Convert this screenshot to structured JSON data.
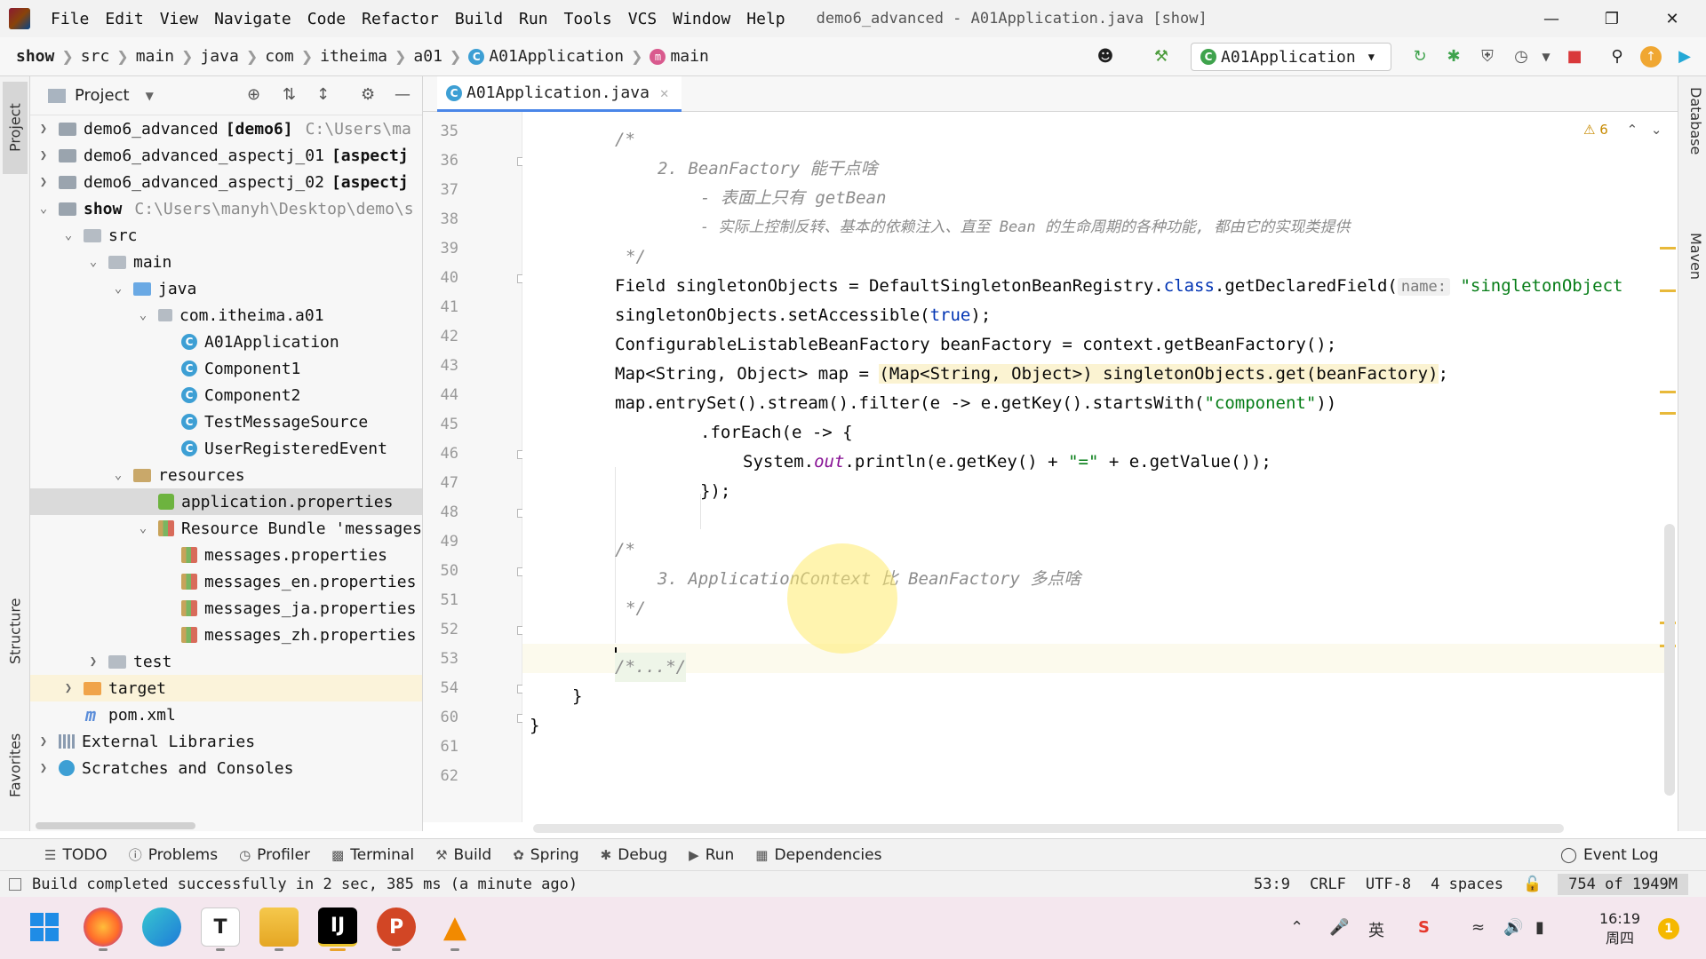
{
  "menu": {
    "items": [
      "File",
      "Edit",
      "View",
      "Navigate",
      "Code",
      "Refactor",
      "Build",
      "Run",
      "Tools",
      "VCS",
      "Window",
      "Help"
    ],
    "window_title": "demo6_advanced - A01Application.java [show]"
  },
  "breadcrumb": [
    "show",
    "src",
    "main",
    "java",
    "com",
    "itheima",
    "a01",
    "A01Application",
    "main"
  ],
  "run_config": "A01Application",
  "project_panel": {
    "title": "Project",
    "tree": [
      {
        "name": "demo6_advanced",
        "tag": "[demo6]",
        "path": "C:\\Users\\ma"
      },
      {
        "name": "demo6_advanced_aspectj_01",
        "tag": "[aspectj",
        "path": ""
      },
      {
        "name": "demo6_advanced_aspectj_02",
        "tag": "[aspectj",
        "path": ""
      },
      {
        "name": "show",
        "tag": "",
        "path": "C:\\Users\\manyh\\Desktop\\demo\\s"
      },
      {
        "name": "src"
      },
      {
        "name": "main"
      },
      {
        "name": "java"
      },
      {
        "name": "com.itheima.a01"
      },
      {
        "name": "A01Application"
      },
      {
        "name": "Component1"
      },
      {
        "name": "Component2"
      },
      {
        "name": "TestMessageSource"
      },
      {
        "name": "UserRegisteredEvent"
      },
      {
        "name": "resources"
      },
      {
        "name": "application.properties"
      },
      {
        "name": "Resource Bundle 'messages'"
      },
      {
        "name": "messages.properties"
      },
      {
        "name": "messages_en.properties"
      },
      {
        "name": "messages_ja.properties"
      },
      {
        "name": "messages_zh.properties"
      },
      {
        "name": "test"
      },
      {
        "name": "target"
      },
      {
        "name": "pom.xml"
      },
      {
        "name": "External Libraries"
      },
      {
        "name": "Scratches and Consoles"
      }
    ]
  },
  "editor": {
    "tab": "A01Application.java",
    "warnings": "6",
    "line_numbers": [
      "35",
      "36",
      "37",
      "38",
      "39",
      "40",
      "41",
      "42",
      "43",
      "44",
      "45",
      "46",
      "47",
      "48",
      "49",
      "50",
      "51",
      "52",
      "53",
      "54",
      "60",
      "61",
      "62"
    ],
    "code": {
      "l36": "/*",
      "l37": "2. BeanFactory 能干点啥",
      "l38": "- 表面上只有 getBean",
      "l39": "- 实际上控制反转、基本的依赖注入、直至 Bean 的生命周期的各种功能, 都由它的实现类提供",
      "l40": "*/",
      "l41a": "Field singletonObjects = DefaultSingletonBeanRegistry.",
      "l41b": "class",
      "l41c": ".getDeclaredField(",
      "l41hint": "name:",
      "l41str": "\"singletonObject",
      "l42a": "singletonObjects.setAccessible(",
      "l42b": "true",
      "l42c": ");",
      "l43": "ConfigurableListableBeanFactory beanFactory = context.getBeanFactory();",
      "l44a": "Map<String, Object> map = ",
      "l44b": "(Map<String, Object>) singletonObjects.get(beanFactory)",
      "l44c": ";",
      "l45a": "map.entrySet().stream().filter(e -> e.getKey().startsWith(",
      "l45b": "\"component\"",
      "l45c": "))",
      "l46": ".forEach(e -> {",
      "l47a": "System.",
      "l47b": "out",
      "l47c": ".println(e.getKey() + ",
      "l47d": "\"=\"",
      "l47e": " + e.getValue());",
      "l48": "});",
      "l50": "/*",
      "l51": "3. ApplicationContext 比 BeanFactory 多点啥",
      "l52": "*/",
      "l54": "/*...*/",
      "l60": "}",
      "l61": "}"
    }
  },
  "side_tabs": {
    "left": [
      "Project",
      "Structure",
      "Favorites"
    ],
    "right": [
      "Database",
      "Maven"
    ]
  },
  "tool_tabs": [
    "TODO",
    "Problems",
    "Profiler",
    "Terminal",
    "Build",
    "Spring",
    "Debug",
    "Run",
    "Dependencies"
  ],
  "event_log": "Event Log",
  "status": {
    "message": "Build completed successfully in 2 sec, 385 ms (a minute ago)",
    "position": "53:9",
    "line_sep": "CRLF",
    "encoding": "UTF-8",
    "indent": "4 spaces",
    "memory": "754 of 1949M"
  },
  "taskbar": {
    "time": "16:19",
    "day": "周四",
    "ime": "英",
    "notifications": "1"
  }
}
